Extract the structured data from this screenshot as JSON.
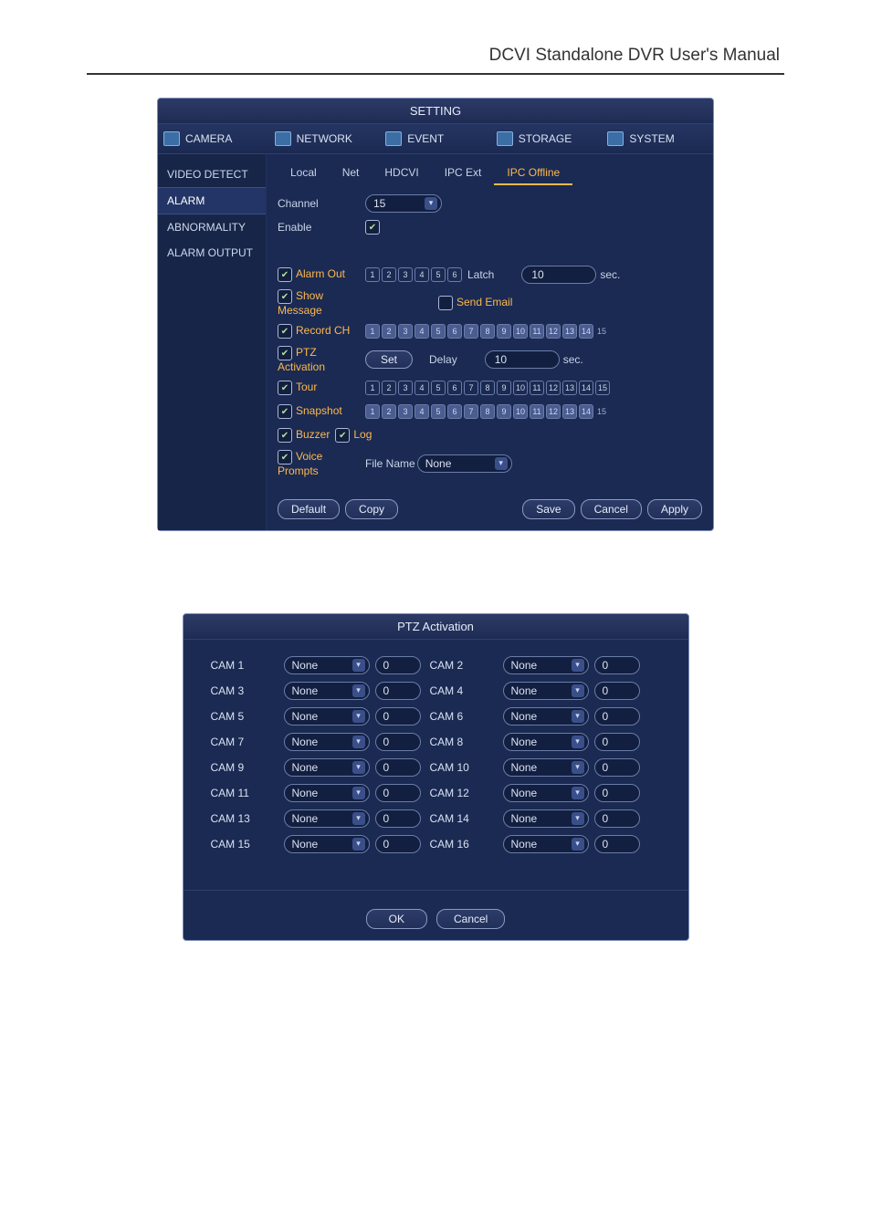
{
  "doc_header": "DCVI Standalone DVR User's Manual",
  "setting_window": {
    "title": "SETTING",
    "tabs": [
      "CAMERA",
      "NETWORK",
      "EVENT",
      "STORAGE",
      "SYSTEM"
    ],
    "sidebar": {
      "items": [
        "VIDEO DETECT",
        "ALARM",
        "ABNORMALITY",
        "ALARM OUTPUT"
      ],
      "active_index": 1
    },
    "subtabs": {
      "items": [
        "Local",
        "Net",
        "HDCVI",
        "IPC Ext",
        "IPC Offline"
      ],
      "active_index": 4
    },
    "fields": {
      "channel_label": "Channel",
      "channel_value": "15",
      "enable_label": "Enable",
      "enable_checked": true,
      "alarm_out_label": "Alarm Out",
      "alarm_out_checked": true,
      "alarm_out_boxes": [
        1,
        2,
        3,
        4,
        5,
        6
      ],
      "latch_label": "Latch",
      "latch_value": "10",
      "latch_unit": "sec.",
      "show_message_label": "Show Message",
      "show_message_checked": true,
      "send_email_label": "Send Email",
      "send_email_checked": false,
      "record_ch_label": "Record CH",
      "record_ch_checked": true,
      "record_ch_boxes": 15,
      "ptz_act_label": "PTZ Activation",
      "ptz_act_checked": true,
      "set_label": "Set",
      "delay_label": "Delay",
      "delay_value": "10",
      "delay_unit": "sec.",
      "tour_label": "Tour",
      "tour_checked": true,
      "tour_boxes": 15,
      "snapshot_label": "Snapshot",
      "snapshot_checked": true,
      "snapshot_boxes": 15,
      "buzzer_label": "Buzzer",
      "buzzer_checked": true,
      "log_label": "Log",
      "log_checked": true,
      "voice_label": "Voice Prompts",
      "voice_checked": true,
      "file_name_label": "File Name",
      "file_name_value": "None"
    },
    "buttons": {
      "default": "Default",
      "copy": "Copy",
      "save": "Save",
      "cancel": "Cancel",
      "apply": "Apply"
    }
  },
  "ptz_window": {
    "title": "PTZ Activation",
    "cams": [
      {
        "label": "CAM 1",
        "mode": "None",
        "val": "0"
      },
      {
        "label": "CAM 2",
        "mode": "None",
        "val": "0"
      },
      {
        "label": "CAM 3",
        "mode": "None",
        "val": "0"
      },
      {
        "label": "CAM 4",
        "mode": "None",
        "val": "0"
      },
      {
        "label": "CAM 5",
        "mode": "None",
        "val": "0"
      },
      {
        "label": "CAM 6",
        "mode": "None",
        "val": "0"
      },
      {
        "label": "CAM 7",
        "mode": "None",
        "val": "0"
      },
      {
        "label": "CAM 8",
        "mode": "None",
        "val": "0"
      },
      {
        "label": "CAM 9",
        "mode": "None",
        "val": "0"
      },
      {
        "label": "CAM 10",
        "mode": "None",
        "val": "0"
      },
      {
        "label": "CAM 11",
        "mode": "None",
        "val": "0"
      },
      {
        "label": "CAM 12",
        "mode": "None",
        "val": "0"
      },
      {
        "label": "CAM 13",
        "mode": "None",
        "val": "0"
      },
      {
        "label": "CAM 14",
        "mode": "None",
        "val": "0"
      },
      {
        "label": "CAM 15",
        "mode": "None",
        "val": "0"
      },
      {
        "label": "CAM 16",
        "mode": "None",
        "val": "0"
      }
    ],
    "ok": "OK",
    "cancel": "Cancel"
  }
}
